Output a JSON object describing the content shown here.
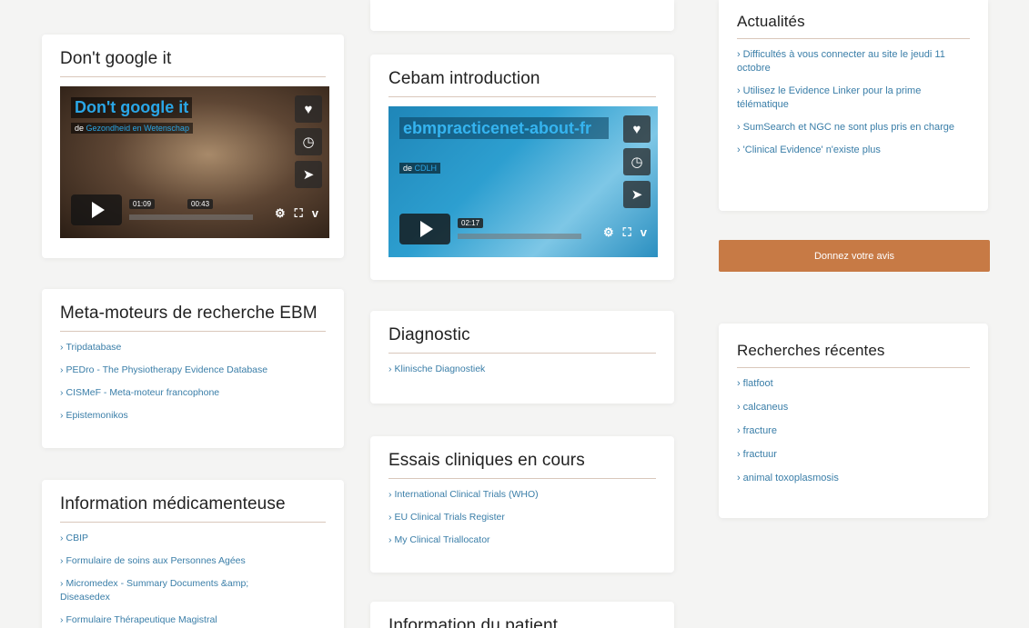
{
  "col1": {
    "dont_google": {
      "title": "Don't google it",
      "video": {
        "title": "Don't google it",
        "by_prefix": "de",
        "by_author": "Gezondheid en Wetenschap",
        "time_elapsed": "01:09",
        "time_hover": "00:43"
      }
    },
    "meta": {
      "title": "Meta-moteurs de recherche EBM",
      "items": [
        "Tripdatabase",
        "PEDro - The Physiotherapy Evidence Database",
        "CISMeF - Meta-moteur francophone",
        "Epistemonikos"
      ]
    },
    "info_med": {
      "title": "Information médicamenteuse",
      "items": [
        "CBIP",
        "Formulaire de soins aux Personnes Agées",
        "Micromedex - Summary Documents &amp; Diseasedex",
        "Formulaire Thérapeutique Magistral"
      ]
    }
  },
  "col2": {
    "cebam": {
      "title": "Cebam introduction",
      "video": {
        "title": "ebmpracticenet-about-fr",
        "by_prefix": "de",
        "by_author": "CDLH",
        "time_elapsed": "02:17"
      }
    },
    "diagnostic": {
      "title": "Diagnostic",
      "items": [
        "Klinische Diagnostiek"
      ]
    },
    "essais": {
      "title": "Essais cliniques en cours",
      "items": [
        "International Clinical Trials (WHO)",
        "EU Clinical Trials Register",
        "My Clinical Triallocator"
      ]
    },
    "info_patient": {
      "title": "Information du patient"
    }
  },
  "col3": {
    "actualites": {
      "title": "Actualités",
      "items": [
        "Difficultés à vous connecter au site le jeudi 11 octobre",
        "Utilisez le Evidence Linker pour la prime télématique",
        "SumSearch et NGC ne sont plus pris en charge",
        "'Clinical Evidence' n'existe plus"
      ]
    },
    "avis_button": "Donnez votre avis",
    "recherches": {
      "title": "Recherches récentes",
      "items": [
        "flatfoot",
        "calcaneus",
        "fracture",
        "fractuur",
        "animal toxoplasmosis"
      ]
    }
  },
  "icons": {
    "heart": "♥",
    "clock": "◷",
    "send": "➤",
    "gear": "⚙",
    "expand": "⛶",
    "vimeo": "v"
  },
  "colors": {
    "accent": "#c77a45",
    "link": "#3a7ea8",
    "video_title": "#2aa6e6"
  }
}
